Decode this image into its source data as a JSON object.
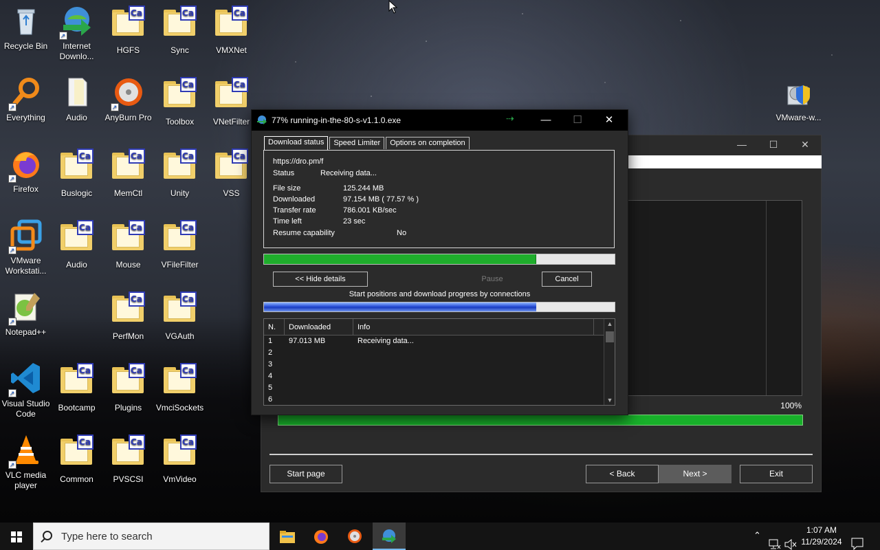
{
  "desktop": {
    "icons": [
      {
        "label": "Recycle Bin"
      },
      {
        "label": "Internet Downlo..."
      },
      {
        "label": "HGFS"
      },
      {
        "label": "Sync"
      },
      {
        "label": "VMXNet"
      },
      {
        "label": "Everything"
      },
      {
        "label": "Audio"
      },
      {
        "label": "AnyBurn Pro"
      },
      {
        "label": "Toolbox"
      },
      {
        "label": "VNetFilter"
      },
      {
        "label": "Firefox"
      },
      {
        "label": "Buslogic"
      },
      {
        "label": "MemCtl"
      },
      {
        "label": "Unity"
      },
      {
        "label": "VSS"
      },
      {
        "label": "VMware Workstati..."
      },
      {
        "label": "Audio"
      },
      {
        "label": "Mouse"
      },
      {
        "label": "VFileFilter"
      },
      {
        "label": "Notepad++"
      },
      {
        "label": "PerfMon"
      },
      {
        "label": "VGAuth"
      },
      {
        "label": "Visual Studio Code"
      },
      {
        "label": "Bootcamp"
      },
      {
        "label": "Plugins"
      },
      {
        "label": "VmciSockets"
      },
      {
        "label": "VLC media player"
      },
      {
        "label": "Common"
      },
      {
        "label": "PVSCSI"
      },
      {
        "label": "VmVideo"
      },
      {
        "label": "VMware-w..."
      }
    ],
    "folder_badge": "Ca"
  },
  "installer": {
    "percent_label": "100%",
    "progress": 1.0,
    "buttons": {
      "start_page": "Start page",
      "back": "< Back",
      "next": "Next >",
      "exit": "Exit"
    }
  },
  "idm": {
    "title": "77% running-in-the-80-s-v1.1.0.exe",
    "tabs": [
      "Download status",
      "Speed Limiter",
      "Options on completion"
    ],
    "url": "https://dro.pm/f",
    "status_label": "Status",
    "status_value": "Receiving data...",
    "fields": [
      {
        "label": "File size",
        "value": "125.244  MB"
      },
      {
        "label": "Downloaded",
        "value": "97.154  MB  ( 77.57 % )"
      },
      {
        "label": "Transfer rate",
        "value": "786.001  KB/sec"
      },
      {
        "label": "Time left",
        "value": "23 sec"
      }
    ],
    "resume_label": "Resume capability",
    "resume_value": "No",
    "progress": 0.7757,
    "buttons": {
      "hide_details": "<< Hide details",
      "pause": "Pause",
      "cancel": "Cancel"
    },
    "connections_caption": "Start positions and download progress by connections",
    "connections_progress": 0.7757,
    "table": {
      "columns": [
        "N.",
        "Downloaded",
        "Info"
      ],
      "rows": [
        {
          "n": "1",
          "downloaded": "97.013  MB",
          "info": "Receiving data..."
        },
        {
          "n": "2",
          "downloaded": "",
          "info": ""
        },
        {
          "n": "3",
          "downloaded": "",
          "info": ""
        },
        {
          "n": "4",
          "downloaded": "",
          "info": ""
        },
        {
          "n": "5",
          "downloaded": "",
          "info": ""
        },
        {
          "n": "6",
          "downloaded": "",
          "info": ""
        }
      ]
    }
  },
  "taskbar": {
    "search_placeholder": "Type here to search",
    "time": "1:07 AM",
    "date": "11/29/2024"
  },
  "colors": {
    "progress_green": "#1fad2c",
    "connection_blue": "#2a4fd6"
  }
}
